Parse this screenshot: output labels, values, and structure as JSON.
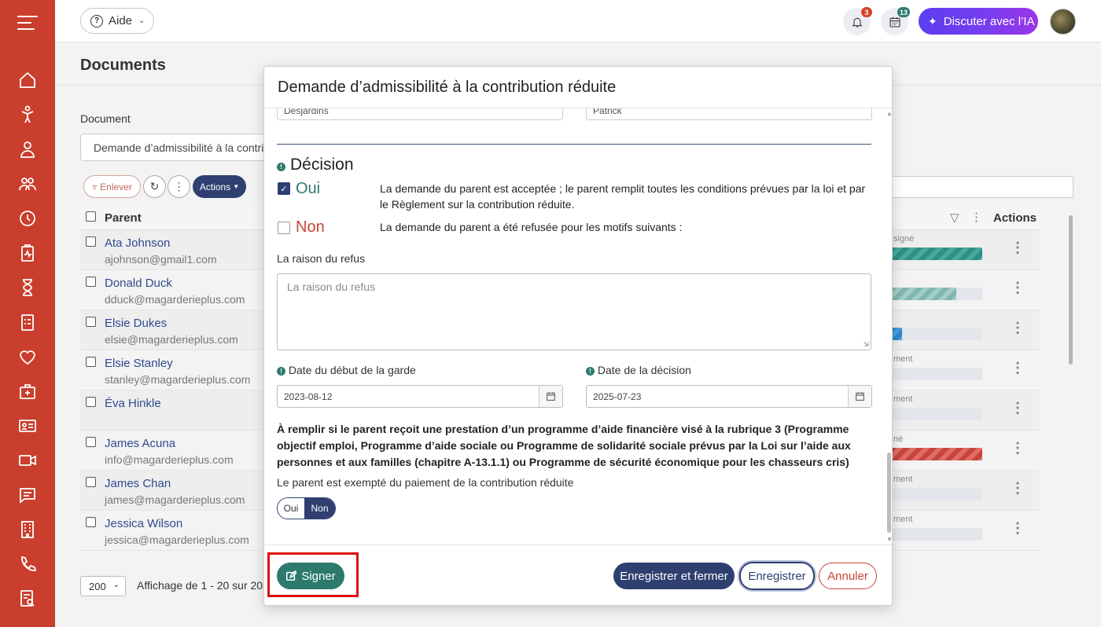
{
  "topbar": {
    "help_label": "Aide",
    "notif_count": "3",
    "calendar_count": "13",
    "ai_label": "Discuter avec l’IA"
  },
  "page": {
    "title": "Documents",
    "document_label": "Document",
    "document_value": "Demande d’admissibilité à la contri",
    "enlever_label": "Enlever",
    "actions_label": "Actions",
    "col_parent": "Parent",
    "col_actions": "Actions",
    "rows": [
      {
        "name": "Ata Johnson",
        "email": "ajohnson@gmail1.com",
        "status": "signé",
        "progress": 1.0,
        "color": "teal"
      },
      {
        "name": "Donald Duck",
        "email": "dduck@magarderieplus.com",
        "status": "",
        "progress": 0.72,
        "color": "teal-light"
      },
      {
        "name": "Elsie Dukes",
        "email": "elsie@magarderieplus.com",
        "status": "",
        "progress": 0.13,
        "color": "blue"
      },
      {
        "name": "Elsie Stanley",
        "email": "stanley@magarderieplus.com",
        "status": "ment",
        "progress": 0,
        "color": "none"
      },
      {
        "name": "Éva Hinkle",
        "email": "",
        "status": "ment",
        "progress": 0,
        "color": "none"
      },
      {
        "name": "James Acuna",
        "email": "info@magarderieplus.com",
        "status": "né",
        "progress": 1.0,
        "color": "red"
      },
      {
        "name": "James Chan",
        "email": "james@magarderieplus.com",
        "status": "ment",
        "progress": 0,
        "color": "none"
      },
      {
        "name": "Jessica Wilson",
        "email": "jessica@magarderieplus.com",
        "status": "ment",
        "progress": 0,
        "color": "none"
      }
    ],
    "per_page": "200",
    "affichage": "Affichage de 1 - 20 sur 20"
  },
  "modal": {
    "title": "Demande d’admissibilité à la contribution réduite",
    "last_name": "Desjardins",
    "first_name": "Patrick",
    "decision_title": "Décision",
    "oui_label": "Oui",
    "oui_desc": "La demande du parent est acceptée ; le parent remplit toutes les conditions prévues par la loi et par le Règlement sur la contribution réduite.",
    "non_label": "Non",
    "non_desc": "La demande du parent a été refusée pour les motifs suivants :",
    "refus_label": "La raison du refus",
    "refus_placeholder": "La raison du refus",
    "date_debut_label": "Date du début de la garde",
    "date_debut_value": "2023-08-12",
    "date_decision_label": "Date de la décision",
    "date_decision_value": "2025-07-23",
    "programme_text": "À remplir si le parent reçoit une prestation d’un programme d’aide financière visé à la rubrique 3 (Programme objectif emploi, Programme d’aide sociale ou Programme de solidarité sociale prévus par la Loi sur l’aide aux personnes et aux familles (chapitre A-13.1.1) ou Programme de sécurité économique pour les chasseurs cris)",
    "exempt_label": "Le parent est exempté du paiement de la contribution réduite",
    "toggle_oui": "Oui",
    "toggle_non": "Non",
    "btn_signer": "Signer",
    "btn_enregistrer_fermer": "Enregistrer et fermer",
    "btn_enregistrer": "Enregistrer",
    "btn_annuler": "Annuler"
  },
  "colors": {
    "sidebar": "#c93e2c",
    "primary": "#2e3f70",
    "teal": "#2c7a6d",
    "danger": "#c84535"
  }
}
